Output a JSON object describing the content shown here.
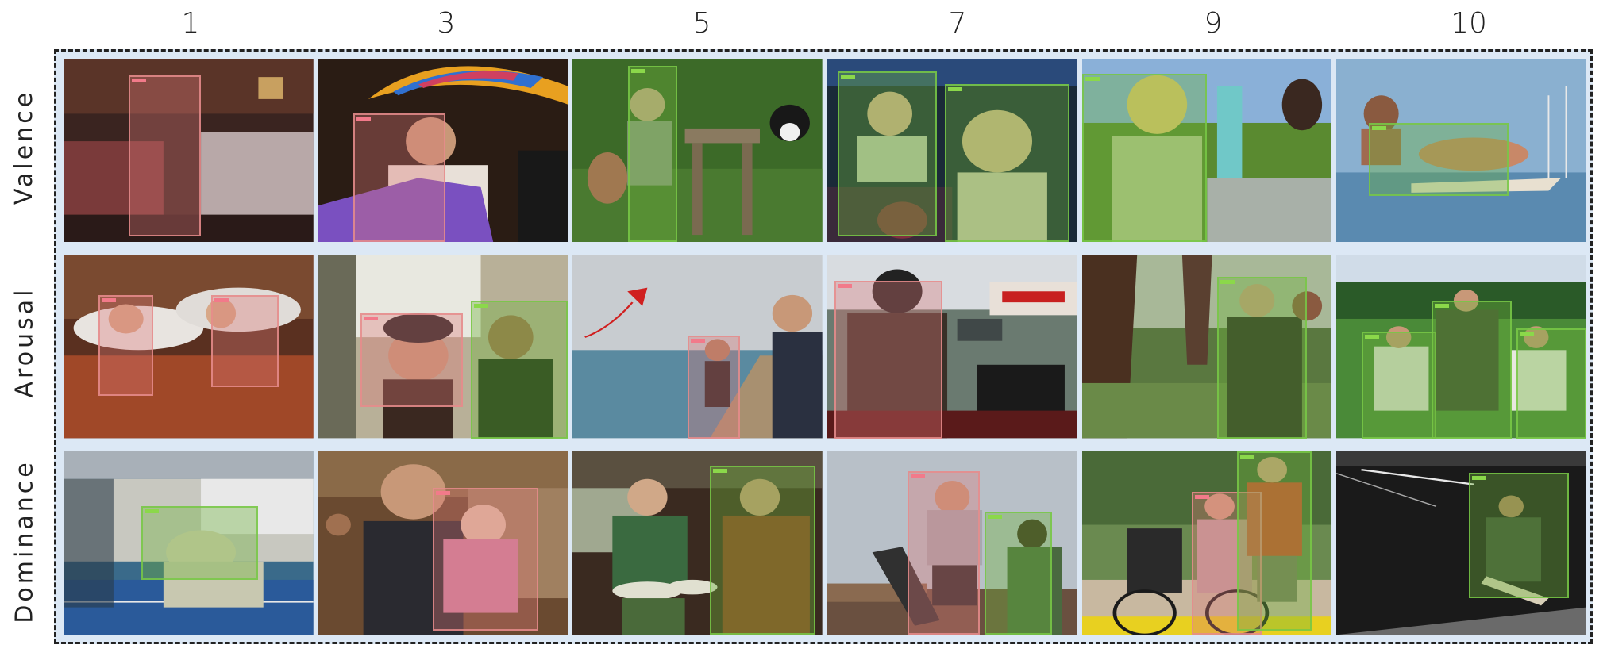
{
  "columns": [
    "1",
    "3",
    "5",
    "7",
    "9",
    "10"
  ],
  "rows": [
    "Valence",
    "Arousal",
    "Dominance"
  ],
  "colors": {
    "frame_bg": "#dce8f5",
    "low_box": "#e68c8c",
    "high_box": "#78c846"
  }
}
